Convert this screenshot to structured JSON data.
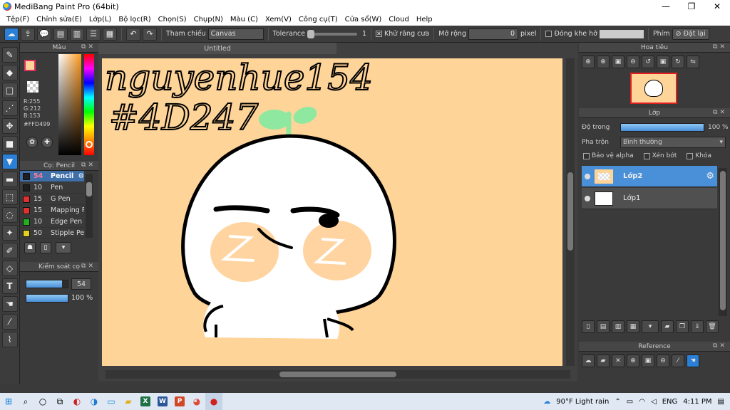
{
  "window": {
    "title": "MediBang Paint Pro (64bit)",
    "minimize": "—",
    "maximize": "❐",
    "close": "✕"
  },
  "menu": [
    "Tệp(F)",
    "Chỉnh sửa(E)",
    "Lớp(L)",
    "Bộ lọc(R)",
    "Chọn(S)",
    "Chụp(N)",
    "Màu (C)",
    "Xem(V)",
    "Công cụ(T)",
    "Cửa sổ(W)",
    "Cloud",
    "Help"
  ],
  "toolbar": {
    "reference_label": "Tham chiếu",
    "reference_value": "Canvas",
    "tolerance_label": "Tolerance",
    "tolerance_value": "1",
    "antialias_label": "Khử răng cưa",
    "expand_label": "Mở rộng",
    "expand_value": "0",
    "expand_unit": "pixel",
    "close_gap_label": "Đóng khe hở",
    "key_label": "Phím",
    "reset_label": "Đặt lại"
  },
  "color_panel": {
    "title": "Màu",
    "r": "R:255",
    "g": "G:212",
    "b": "B:153",
    "hex": "#FFD499",
    "primary_color": "#FFD499"
  },
  "brush_panel": {
    "title": "Cọ: Pencil",
    "brushes": [
      {
        "size": "54",
        "name": "Pencil",
        "color": "#1e1e1e"
      },
      {
        "size": "10",
        "name": "Pen",
        "color": "#1e1e1e"
      },
      {
        "size": "15",
        "name": "G Pen",
        "color": "#e03030"
      },
      {
        "size": "15",
        "name": "Mapping P",
        "color": "#e03030"
      },
      {
        "size": "10",
        "name": "Edge Pen",
        "color": "#20b020"
      },
      {
        "size": "50",
        "name": "Stipple Pe",
        "color": "#e0d020"
      }
    ]
  },
  "brush_control": {
    "title": "Kiểm soát cọ",
    "size_value": "54",
    "opacity_value": "100 %",
    "size_fraction": 0.86,
    "opacity_fraction": 1.0
  },
  "document": {
    "tab_title": "Untitled",
    "text_line1": "nguyenhue154",
    "text_line2": "#4D247"
  },
  "navigator": {
    "title": "Hoa tiêu"
  },
  "layer_panel": {
    "title": "Lớp",
    "opacity_label": "Độ trong",
    "opacity_value": "100 %",
    "opacity_fraction": 1.0,
    "blend_label": "Pha trộn",
    "blend_value": "Bình thường",
    "protect_alpha": "Bảo vệ alpha",
    "clipping": "Xén bớt",
    "lock": "Khóa",
    "layers": [
      {
        "name": "Lớp2",
        "selected": true
      },
      {
        "name": "Lớp1",
        "selected": false
      }
    ]
  },
  "reference_panel": {
    "title": "Reference"
  },
  "taskbar": {
    "weather": "90°F  Light rain",
    "lang": "ENG",
    "time": "4:11 PM"
  }
}
